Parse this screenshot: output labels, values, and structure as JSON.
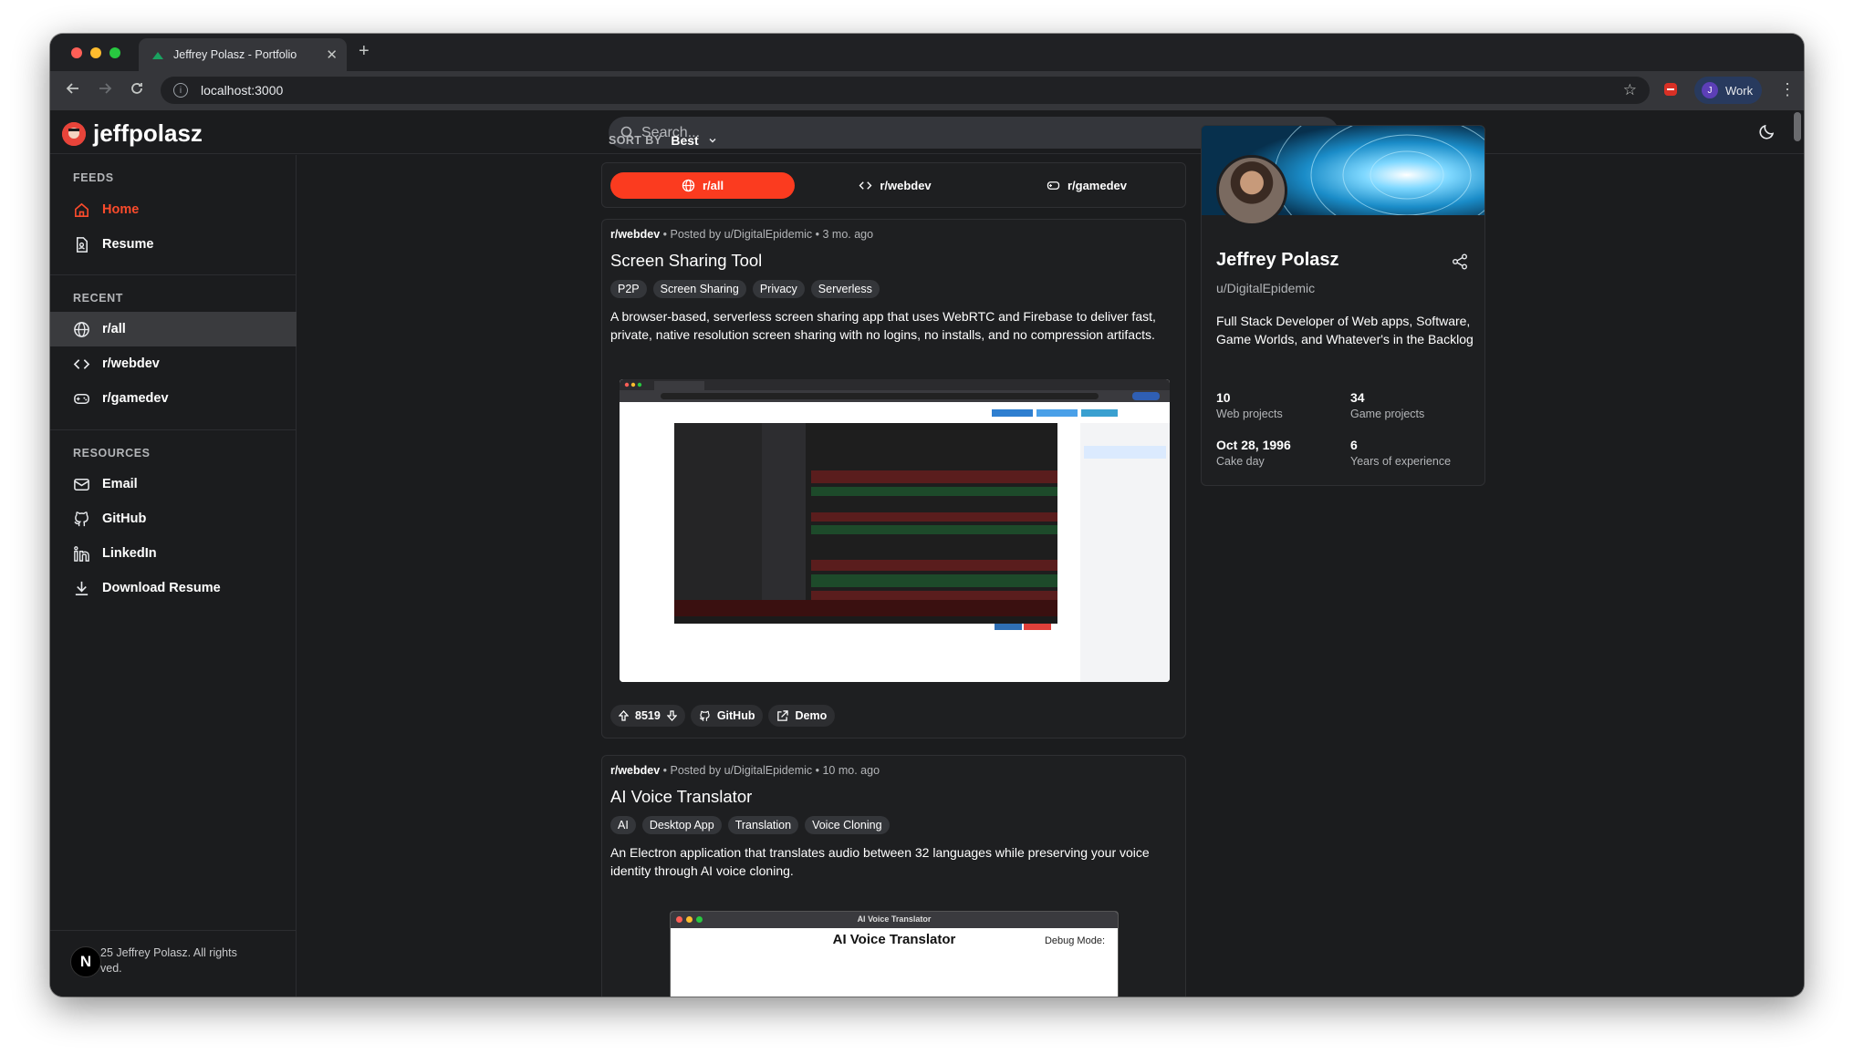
{
  "browser": {
    "tab_title": "Jeffrey Polasz - Portfolio",
    "url": "localhost:3000",
    "profile_initial": "J",
    "profile_label": "Work"
  },
  "site": {
    "logo_text": "jeffpolasz",
    "search_placeholder": "Search..."
  },
  "sidebar": {
    "feeds_title": "FEEDS",
    "feeds": [
      {
        "label": "Home",
        "icon": "home-icon"
      },
      {
        "label": "Resume",
        "icon": "resume-icon"
      }
    ],
    "recent_title": "RECENT",
    "recent": [
      {
        "label": "r/all",
        "icon": "globe-icon"
      },
      {
        "label": "r/webdev",
        "icon": "code-icon"
      },
      {
        "label": "r/gamedev",
        "icon": "gamepad-icon"
      }
    ],
    "resources_title": "RESOURCES",
    "resources": [
      {
        "label": "Email",
        "icon": "mail-icon"
      },
      {
        "label": "GitHub",
        "icon": "github-icon"
      },
      {
        "label": "LinkedIn",
        "icon": "linkedin-icon"
      },
      {
        "label": "Download Resume",
        "icon": "download-icon"
      }
    ],
    "footer_text": "25 Jeffrey Polasz. All rights ved.",
    "footer_badge": "N"
  },
  "feed": {
    "sort_label": "SORT BY",
    "sort_value": "Best",
    "filters": [
      {
        "label": "r/all",
        "icon": "globe-icon"
      },
      {
        "label": "r/webdev",
        "icon": "code-icon"
      },
      {
        "label": "r/gamedev",
        "icon": "gamepad-icon"
      }
    ],
    "posts": [
      {
        "subreddit": "r/webdev",
        "meta": "• Posted by u/DigitalEpidemic • 3 mo. ago",
        "title": "Screen Sharing Tool",
        "tags": [
          "P2P",
          "Screen Sharing",
          "Privacy",
          "Serverless"
        ],
        "description": "A browser-based, serverless screen sharing app that uses WebRTC and Firebase to deliver fast, private, native resolution screen sharing with no logins, no installs, and no compression artifacts.",
        "votes": "8519",
        "github_label": "GitHub",
        "demo_label": "Demo"
      },
      {
        "subreddit": "r/webdev",
        "meta": "• Posted by u/DigitalEpidemic • 10 mo. ago",
        "title": "AI Voice Translator",
        "tags": [
          "AI",
          "Desktop App",
          "Translation",
          "Voice Cloning"
        ],
        "description": "An Electron application that translates audio between 32 languages while preserving your voice identity through AI voice cloning.",
        "preview_title": "AI Voice Translator",
        "preview_window_title": "AI Voice Translator",
        "preview_debug": "Debug Mode:"
      }
    ]
  },
  "profile": {
    "name": "Jeffrey Polasz",
    "username": "u/DigitalEpidemic",
    "bio": "Full Stack Developer of Web apps, Software, Game Worlds, and Whatever's in the Backlog",
    "stats": [
      {
        "value": "10",
        "label": "Web projects"
      },
      {
        "value": "34",
        "label": "Game projects"
      },
      {
        "value": "Oct 28, 1996",
        "label": "Cake day"
      },
      {
        "value": "6",
        "label": "Years of experience"
      }
    ]
  },
  "colors": {
    "accent": "#fb3b1f",
    "background": "#1b1c1e",
    "card": "#1e1f21"
  }
}
